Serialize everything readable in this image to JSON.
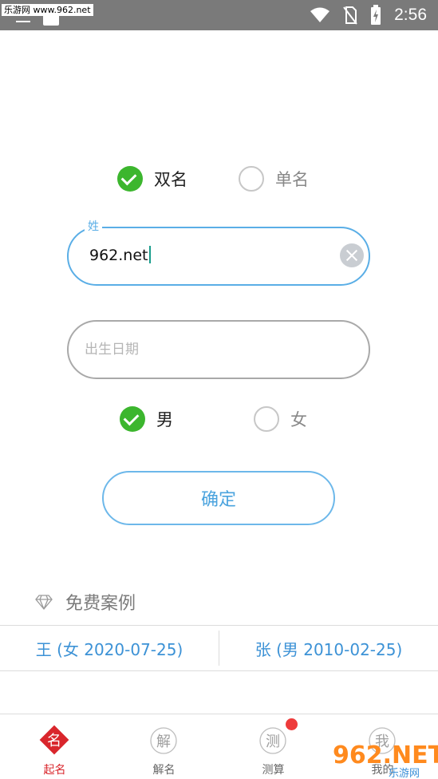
{
  "status_bar": {
    "watermark": "乐游网 www.962.net",
    "time": "2:56"
  },
  "name_type": {
    "double": "双名",
    "single": "单名",
    "selected": "double"
  },
  "surname_field": {
    "legend": "姓",
    "value": "962.net"
  },
  "birth_field": {
    "placeholder": "出生日期"
  },
  "gender": {
    "male": "男",
    "female": "女",
    "selected": "male"
  },
  "confirm_button": "确定",
  "free_examples": {
    "title": "免费案例",
    "items": [
      "王 (女 2020-07-25)",
      "张 (男 2010-02-25)"
    ]
  },
  "tabs": [
    {
      "label": "起名",
      "glyph": "名",
      "active": true
    },
    {
      "label": "解名",
      "glyph": "解",
      "active": false
    },
    {
      "label": "测算",
      "glyph": "测",
      "active": false
    },
    {
      "label": "我的",
      "glyph": "我",
      "active": false
    }
  ],
  "logo_watermark": {
    "brand": "962.NET",
    "sub": "乐游网"
  },
  "colors": {
    "accent": "#5aaee6",
    "check": "#3cb62e",
    "active_tab": "#d9262c",
    "badge": "#ee3b3b"
  }
}
